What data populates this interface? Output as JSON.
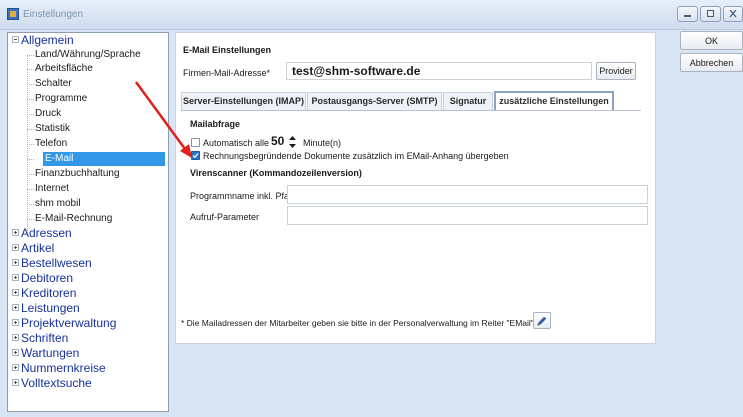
{
  "window": {
    "title": "Einstellungen"
  },
  "tree": {
    "allgemein": {
      "label": "Allgemein",
      "children": [
        "Land/Währung/Sprache",
        "Arbeitsfläche",
        "Schalter",
        "Programme",
        "Druck",
        "Statistik",
        "Telefon",
        "E-Mail",
        "Finanzbuchhaltung",
        "Internet",
        "shm mobil",
        "E-Mail-Rechnung"
      ],
      "selected": "E-Mail"
    },
    "groups": [
      "Adressen",
      "Artikel",
      "Bestellwesen",
      "Debitoren",
      "Kreditoren",
      "Leistungen",
      "Projektverwaltung",
      "Schriften",
      "Wartungen",
      "Nummernkreise",
      "Volltextsuche"
    ]
  },
  "panel": {
    "heading": "E-Mail Einstellungen",
    "company_mail_label": "Firmen-Mail-Adresse*",
    "company_mail_value": "test@shm-software.de",
    "provider_button": "Provider",
    "tabs": [
      "Server-Einstellungen (IMAP)",
      "Postausgangs-Server (SMTP)",
      "Signatur",
      "zusätzliche Einstellungen"
    ],
    "active_tab": "zusätzliche Einstellungen",
    "mailabfrage": {
      "heading": "Mailabfrage",
      "auto_label": "Automatisch alle",
      "auto_checked": false,
      "interval_value": "50",
      "interval_unit": "Minute(n)",
      "attach_label": "Rechnungsbegründende Dokumente zusätzlich im EMail-Anhang übergeben",
      "attach_checked": true
    },
    "virenscanner": {
      "heading": "Virenscanner (Kommandozeilenversion)",
      "program_label": "Programmname inkl. Pfad",
      "program_value": "",
      "params_label": "Aufruf-Parameter",
      "params_value": ""
    },
    "footer_note": "* Die Mailadressen der Mitarbeiter geben sie bitte in der Personalverwaltung im Reiter \"EMail\" ein:"
  },
  "buttons": {
    "ok": "OK",
    "cancel": "Abbrechen"
  },
  "colors": {
    "accent": "#3397e8",
    "annotation_arrow": "#e0201b",
    "tree_group_text": "#17329b"
  },
  "icons": {
    "app": "settings-app-icon",
    "edit": "pencil-icon",
    "annotation": "red-arrow-annotation"
  }
}
